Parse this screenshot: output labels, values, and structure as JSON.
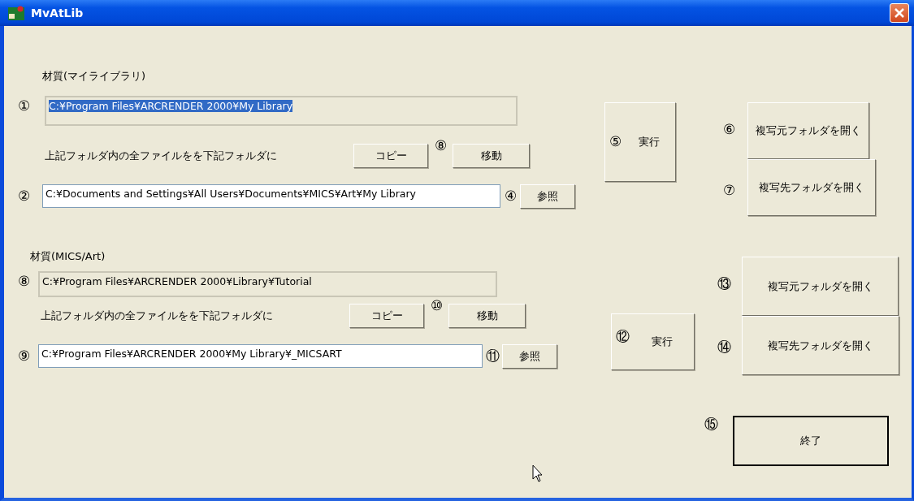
{
  "window": {
    "title": "MvAtLib"
  },
  "sections": [
    {
      "heading": "材質(マイライブラリ)",
      "source": {
        "marker": "①",
        "value": "C:¥Program Files¥ARCRENDER 2000¥My Library",
        "readonly": true,
        "highlighted": true
      },
      "instruction": "上記フォルダ内の全ファイルをを下記フォルダに",
      "copy_button": "コピー",
      "move_marker": "⑧",
      "move_button": "移動",
      "destination": {
        "marker": "②",
        "value": "C:¥Documents and Settings¥All Users¥Documents¥MICS¥Art¥My Library",
        "readonly": false,
        "highlighted": false
      },
      "browse_marker": "④",
      "browse_button": "参照",
      "run_marker": "⑤",
      "run_button": "実行",
      "open_buttons": [
        {
          "marker": "⑥",
          "label": "複写元フォルダを開く"
        },
        {
          "marker": "⑦",
          "label": "複写先フォルダを開く"
        }
      ]
    },
    {
      "heading": "材質(MICS/Art)",
      "source": {
        "marker": "⑧",
        "value": "C:¥Program Files¥ARCRENDER 2000¥Library¥Tutorial",
        "readonly": true,
        "highlighted": false
      },
      "instruction": "上記フォルダ内の全ファイルをを下記フォルダに",
      "copy_button": "コピー",
      "move_marker": "⑩",
      "move_button": "移動",
      "destination": {
        "marker": "⑨",
        "value": "C:¥Program Files¥ARCRENDER 2000¥My Library¥_MICSART",
        "readonly": false,
        "highlighted": false
      },
      "browse_marker": "⑪",
      "browse_button": "参照",
      "run_marker": "⑫",
      "run_button": "実行",
      "open_buttons": [
        {
          "marker": "⑬",
          "label": "複写元フォルダを開く"
        },
        {
          "marker": "⑭",
          "label": "複写先フォルダを開く"
        }
      ]
    }
  ],
  "exit": {
    "marker": "⑮",
    "label": "終了",
    "default": true
  }
}
